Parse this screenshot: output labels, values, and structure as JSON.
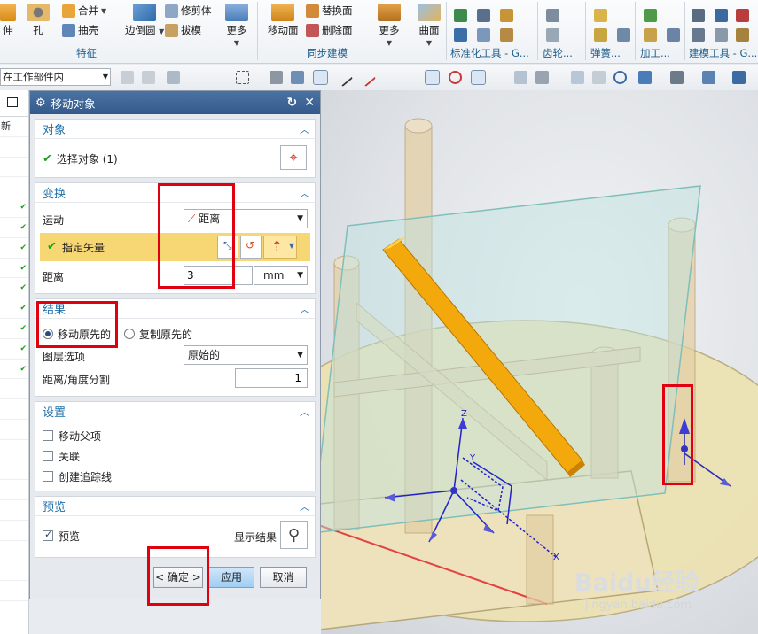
{
  "ribbon": {
    "items": [
      {
        "label": "伸",
        "icon": "extrude-icon"
      },
      {
        "label": "孔",
        "icon": "hole-icon"
      },
      {
        "label": "合并",
        "icon": "unite-icon"
      },
      {
        "label": "抽壳",
        "icon": "shell-icon"
      },
      {
        "label": "边倒圆",
        "icon": "edge-blend-icon"
      },
      {
        "label": "修剪体",
        "icon": "trim-body-icon"
      },
      {
        "label": "拔模",
        "icon": "draft-icon"
      },
      {
        "label": "更多",
        "icon": "more-icon"
      },
      {
        "label": "移动面",
        "icon": "move-face-icon"
      },
      {
        "label": "替换面",
        "icon": "replace-face-icon"
      },
      {
        "label": "删除面",
        "icon": "delete-face-icon"
      },
      {
        "label": "更多",
        "icon": "more-icon"
      },
      {
        "label": "曲面",
        "icon": "surface-icon"
      }
    ],
    "groups": [
      "特征",
      "同步建模",
      "标准化工具 - G...",
      "齿轮...",
      "弹簧...",
      "加工...",
      "建模工具 - G..."
    ]
  },
  "toolbar2": {
    "scope": "在工作部件内"
  },
  "left_panel": {
    "header": "新"
  },
  "dialog": {
    "title": "移动对象",
    "sections": {
      "object": {
        "title": "对象",
        "select_label": "选择对象 (1)"
      },
      "transform": {
        "title": "变换",
        "motion_label": "运动",
        "motion_value": "距离",
        "vector_label": "指定矢量",
        "distance_label": "距离",
        "distance_value": "3",
        "unit_value": "mm"
      },
      "result": {
        "title": "结果",
        "move_original": "移动原先的",
        "copy_original": "复制原先的",
        "layer_label": "图层选项",
        "layer_value": "原始的",
        "split_label": "距离/角度分割",
        "split_value": "1"
      },
      "settings": {
        "title": "设置",
        "move_parent": "移动父项",
        "associative": "关联",
        "create_trace": "创建追踪线"
      },
      "preview": {
        "title": "预览",
        "preview_label": "预览",
        "show_result": "显示结果"
      }
    },
    "buttons": {
      "ok": "< 确定 >",
      "apply": "应用",
      "cancel": "取消"
    }
  },
  "viewport": {
    "axis_z": "Z",
    "axis_y": "Y",
    "axis_x": "X"
  },
  "watermark": {
    "brand": "Baidu经验",
    "url": "jingyan.baidu.com"
  },
  "colors": {
    "accent": "#1e6ea8",
    "highlight_row": "#f7d774",
    "red_box": "#e00010",
    "bar": "#f3a90c"
  }
}
